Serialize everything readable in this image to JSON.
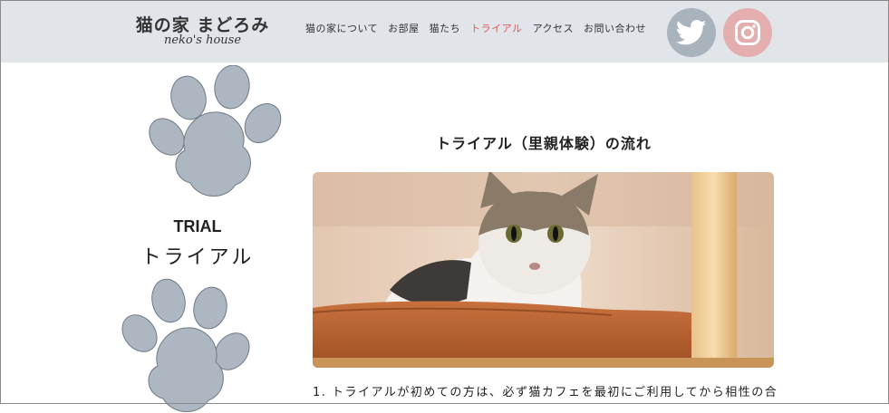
{
  "header": {
    "logo_jp": "猫の家 まどろみ",
    "logo_en": "neko's house",
    "nav": [
      {
        "label": "猫の家について"
      },
      {
        "label": "お部屋"
      },
      {
        "label": "猫たち"
      },
      {
        "label": "トライアル",
        "active": true
      },
      {
        "label": "アクセス"
      },
      {
        "label": "お問い合わせ"
      }
    ],
    "social": [
      {
        "icon": "twitter-icon",
        "color": "#a9b3bc"
      },
      {
        "icon": "instagram-icon",
        "color": "#e5aeae"
      }
    ],
    "bg_color": "#e1e5ea",
    "active_color": "#e05a5a"
  },
  "sidebar": {
    "title_en": "TRIAL",
    "title_jp": "トライアル",
    "paw_color": "#acb7c1"
  },
  "main": {
    "section_title": "トライアル（里親体験）の流れ",
    "photo_alt": "cat-photo",
    "step1": "1. トライアルが初めての方は、必ず猫カフェを最初にご利用してから相性の合"
  }
}
